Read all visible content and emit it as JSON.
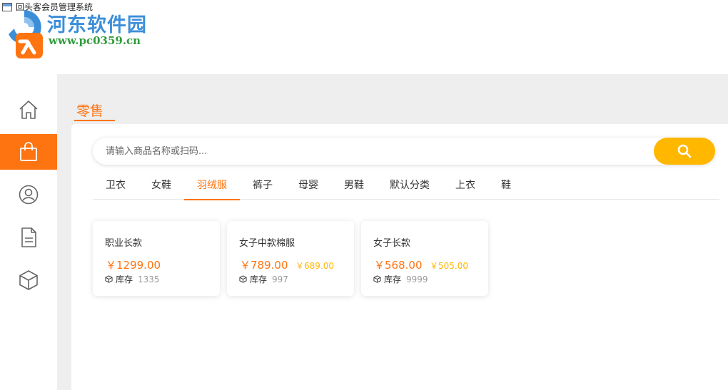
{
  "window": {
    "title": "回头客会员管理系统"
  },
  "watermark": {
    "name": "河东软件园",
    "url": "www.pc0359.cn"
  },
  "sidebar": {
    "items": [
      {
        "icon": "home-icon",
        "active": false
      },
      {
        "icon": "shopping-bag-icon",
        "active": true
      },
      {
        "icon": "user-circle-icon",
        "active": false
      },
      {
        "icon": "document-icon",
        "active": false
      },
      {
        "icon": "box-icon",
        "active": false
      }
    ]
  },
  "page": {
    "title": "零售"
  },
  "search": {
    "placeholder": "请输入商品名称或扫码...",
    "value": "",
    "button_icon": "search-icon"
  },
  "tabs": [
    {
      "label": "卫衣",
      "active": false
    },
    {
      "label": "女鞋",
      "active": false
    },
    {
      "label": "羽绒服",
      "active": true
    },
    {
      "label": "裤子",
      "active": false
    },
    {
      "label": "母婴",
      "active": false
    },
    {
      "label": "男鞋",
      "active": false
    },
    {
      "label": "默认分类",
      "active": false
    },
    {
      "label": "上衣",
      "active": false
    },
    {
      "label": "鞋",
      "active": false
    }
  ],
  "products": [
    {
      "name": "职业长款",
      "price": "￥1299.00",
      "vip_price": "",
      "stock_label": "库存",
      "stock": "1335"
    },
    {
      "name": "女子中款棉服",
      "price": "￥789.00",
      "vip_price": "￥689.00",
      "stock_label": "库存",
      "stock": "997"
    },
    {
      "name": "女子长款",
      "price": "￥568.00",
      "vip_price": "￥505.00",
      "stock_label": "库存",
      "stock": "9999"
    }
  ],
  "colors": {
    "accent": "#fe7410",
    "search_button": "#ffb700",
    "background": "#eeeeee"
  }
}
